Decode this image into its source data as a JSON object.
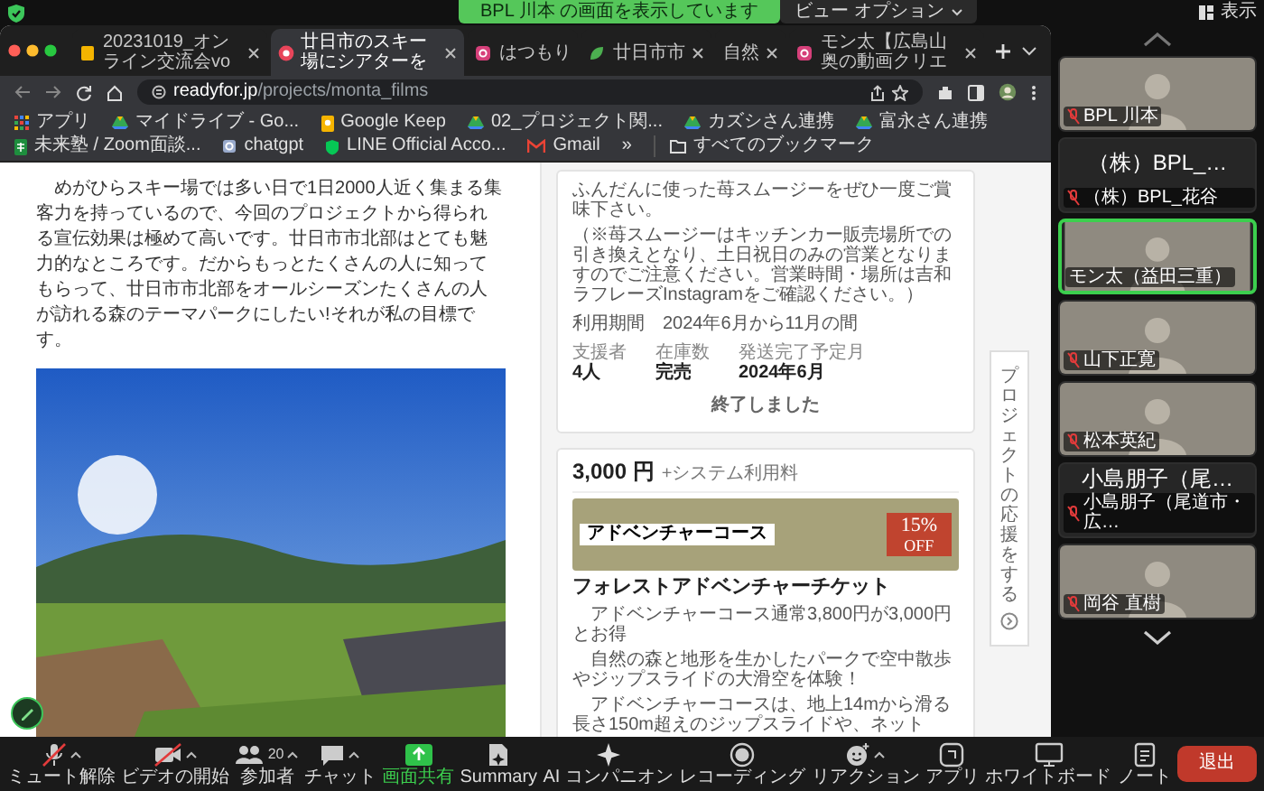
{
  "share_banner": {
    "text": "BPL 川本 の画面を表示しています",
    "view_options": "ビュー オプション"
  },
  "view_button": "表示",
  "browser": {
    "tabs": [
      {
        "title": "20231019_オンライン交流会vo",
        "close": true,
        "selected": false
      },
      {
        "title": "廿日市のスキー場にシアターを",
        "close": true,
        "selected": true
      },
      {
        "title": "はつもり",
        "close": false,
        "selected": false
      },
      {
        "title": "廿日市市",
        "close": true,
        "selected": false
      },
      {
        "title": "自然",
        "close": true,
        "selected": false
      },
      {
        "title": "モン太【広島山奥の動画クリエ",
        "close": true,
        "selected": false
      }
    ],
    "address": {
      "domain": "readyfor.jp",
      "path": "/projects/monta_films"
    },
    "bookmarks": [
      {
        "label": "アプリ"
      },
      {
        "label": "マイドライブ - Go..."
      },
      {
        "label": "Google Keep"
      },
      {
        "label": "02_プロジェクト関..."
      },
      {
        "label": "カズシさん連携"
      },
      {
        "label": "富永さん連携"
      },
      {
        "label": "未来塾 / Zoom面談..."
      },
      {
        "label": "chatgpt"
      },
      {
        "label": "LINE Official Acco..."
      },
      {
        "label": "Gmail"
      }
    ],
    "bookmarks_more": "»",
    "all_bookmarks": "すべてのブックマーク"
  },
  "page": {
    "intro": "めがひらスキー場では多い日で1日2000人近く集まる集客力を持っているので、今回のプロジェクトから得られる宣伝効果は極めて高いです。廿日市市北部はとても魅力的なところです。だからもっとたくさんの人に知ってもらって、廿日市市北部をオールシーズンたくさんの人が訪れる森のテーマパークにしたい!それが私の目標です。",
    "reward_cards": [
      {
        "kind": "ended",
        "description": [
          "ふんだんに使った苺スムージーをぜひ一度ご賞味下さい。",
          "（※苺スムージーはキッチンカー販売場所での引き換えとなり、土日祝日のみの営業となりますのでご注意ください。営業時間・場所は吉和ラフレーズInstagramをご確認ください。）"
        ],
        "period": "利用期間　2024年6月から11月の間",
        "stats": [
          {
            "label": "支援者",
            "value": "4人"
          },
          {
            "label": "在庫数",
            "value": "完売"
          },
          {
            "label": "発送完了予定月",
            "value": "2024年6月"
          }
        ],
        "status": "終了しました"
      },
      {
        "kind": "offer",
        "price": "3,000 円",
        "fee": "+システム利用料",
        "banner": {
          "title": "アドベンチャーコース",
          "discount": "15%",
          "off": "OFF"
        },
        "title": "フォレストアドベンチャーチケット",
        "description": [
          "アドベンチャーコース通常3,800円が3,000円とお得",
          "自然の森と地形を生かしたパークで空中散歩やジップスライドの大滑空を体験！",
          "アドベンチャーコースは、地上14mから滑る長さ150m超えのジップスライドや、ネット"
        ]
      }
    ],
    "support_tab": "プロジェクトの応援をする"
  },
  "participants": [
    {
      "kind": "video",
      "label": "BPL 川本",
      "muted": true,
      "active": false
    },
    {
      "kind": "name",
      "display": "（株）BPL_…",
      "label": "（株）BPL_花谷",
      "muted": true,
      "active": false
    },
    {
      "kind": "video",
      "label": "モン太（益田三重）",
      "muted": false,
      "active": true
    },
    {
      "kind": "video",
      "label": "山下正寛",
      "muted": true,
      "active": false
    },
    {
      "kind": "video",
      "label": "松本英紀",
      "muted": true,
      "active": false
    },
    {
      "kind": "name",
      "display": "小島朋子（尾…",
      "label": "小島朋子（尾道市・広…",
      "muted": true,
      "active": false
    },
    {
      "kind": "video",
      "label": "岡谷 直樹",
      "muted": true,
      "active": false
    }
  ],
  "toolbar": [
    {
      "label": "ミュート解除",
      "caret": true,
      "active": false
    },
    {
      "label": "ビデオの開始",
      "caret": true,
      "active": false
    },
    {
      "label": "参加者",
      "count": "20",
      "caret": true,
      "active": false
    },
    {
      "label": "チャット",
      "caret": true,
      "active": false
    },
    {
      "label": "画面共有",
      "caret": false,
      "active": true
    },
    {
      "label": "Summary",
      "caret": false,
      "active": false
    },
    {
      "label": "AI コンパニオン",
      "caret": false,
      "active": false
    },
    {
      "label": "レコーディング",
      "caret": false,
      "active": false
    },
    {
      "label": "リアクション",
      "caret": true,
      "active": false
    },
    {
      "label": "アプリ",
      "caret": false,
      "active": false
    },
    {
      "label": "ホワイトボード",
      "caret": false,
      "active": false
    },
    {
      "label": "ノート",
      "caret": false,
      "active": false
    }
  ],
  "leave_button": "退出"
}
